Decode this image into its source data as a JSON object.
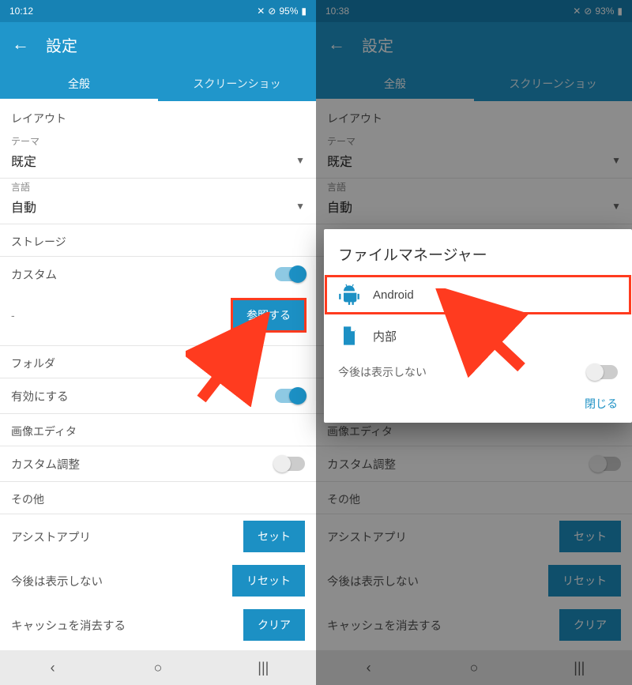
{
  "colors": {
    "accent": "#2096cb",
    "highlight": "#ff3b1f"
  },
  "left": {
    "status_time": "10:12",
    "status_batt": "95%",
    "title": "設定",
    "tabs": {
      "general": "全般",
      "screenshot": "スクリーンショッ"
    },
    "layout_header": "レイアウト",
    "theme_label": "テーマ",
    "theme_value": "既定",
    "lang_label": "言語",
    "lang_value": "自動",
    "storage_header": "ストレージ",
    "custom_label": "カスタム",
    "path_value": "-",
    "browse_btn": "参照する",
    "folder_header": "フォルダ",
    "enable_label": "有効にする",
    "editor_header": "画像エディタ",
    "adjust_label": "カスタム調整",
    "other_header": "その他",
    "assist_label": "アシストアプリ",
    "set_btn": "セット",
    "hide_label": "今後は表示しない",
    "reset_btn": "リセット",
    "cache_label": "キャッシュを消去する",
    "clear_btn": "クリア"
  },
  "right": {
    "status_time": "10:38",
    "status_batt": "93%",
    "title": "設定",
    "dialog_title": "ファイルマネージャー",
    "item_android": "Android",
    "item_internal": "内部",
    "dont_show": "今後は表示しない",
    "close": "閉じる"
  }
}
